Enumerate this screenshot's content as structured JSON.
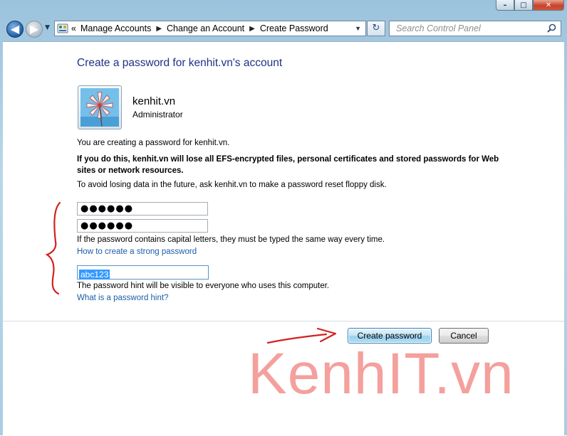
{
  "window": {
    "minimize_glyph": "–",
    "maximize_glyph": "□",
    "close_glyph": "✕"
  },
  "navigation": {
    "back_glyph": "◀",
    "forward_glyph": "▶",
    "breadcrumb_prefix": "«",
    "breadcrumb": [
      "Manage Accounts",
      "Change an Account",
      "Create Password"
    ],
    "separator": "▶",
    "refresh_glyph": "↻",
    "search_placeholder": "Search Control Panel"
  },
  "page": {
    "title": "Create a password for kenhit.vn's account",
    "user": {
      "name": "kenhit.vn",
      "role": "Administrator"
    },
    "intro": "You are creating a password for kenhit.vn.",
    "warning": "If you do this, kenhit.vn will lose all EFS-encrypted files, personal certificates and stored passwords for Web sites or network resources.",
    "advice": "To avoid losing data in the future, ask kenhit.vn to make a password reset floppy disk.",
    "new_password_value": "●●●●●●",
    "confirm_password_value": "●●●●●●",
    "case_note": "If the password contains capital letters, they must be typed the same way every time.",
    "strong_password_link": "How to create a strong password",
    "hint_value": "abc123",
    "hint_note": "The password hint will be visible to everyone who uses this computer.",
    "hint_link": "What is a password hint?"
  },
  "buttons": {
    "create": "Create password",
    "cancel": "Cancel"
  },
  "watermark": "KenhIT.vn",
  "colors": {
    "title_blue": "#1e3287",
    "link_blue": "#1b5ea8",
    "annotation_red": "#d42020",
    "watermark": "#f07c78",
    "selection": "#3399ff"
  }
}
